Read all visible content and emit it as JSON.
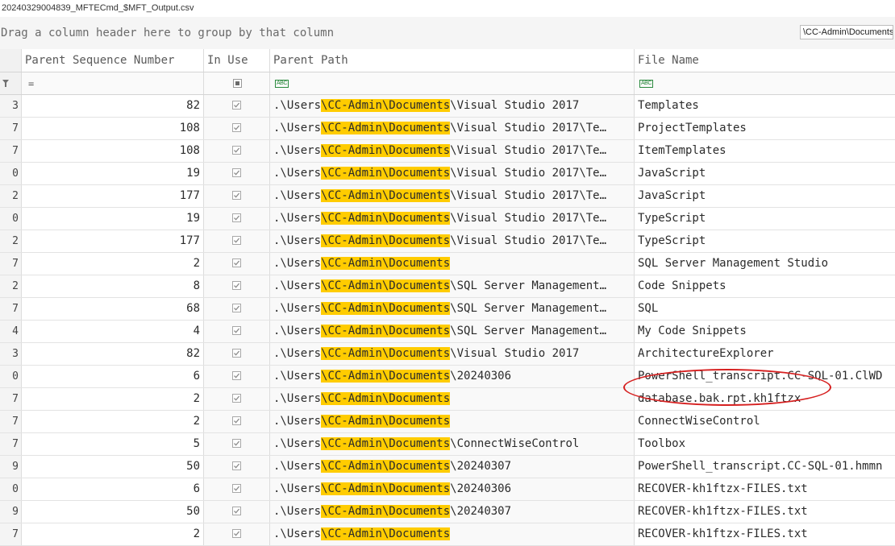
{
  "window": {
    "title": "20240329004839_MFTECmd_$MFT_Output.csv"
  },
  "group_panel": {
    "hint": "Drag a column header here to group by that column"
  },
  "search": {
    "value": "\\CC-Admin\\Documents"
  },
  "columns": {
    "parent_sequence_number": "Parent Sequence Number",
    "in_use": "In Use",
    "parent_path": "Parent Path",
    "file_name": "File Name"
  },
  "filter_row": {
    "numeric_operator": "="
  },
  "rows": [
    {
      "edge": "3",
      "psn": "82",
      "path_prefix": ".\\Users",
      "path_hl": "\\CC-Admin\\Documents",
      "path_suffix": "\\Visual Studio 2017",
      "file": "Templates"
    },
    {
      "edge": "7",
      "psn": "108",
      "path_prefix": ".\\Users",
      "path_hl": "\\CC-Admin\\Documents",
      "path_suffix": "\\Visual Studio 2017\\Te…",
      "file": "ProjectTemplates"
    },
    {
      "edge": "7",
      "psn": "108",
      "path_prefix": ".\\Users",
      "path_hl": "\\CC-Admin\\Documents",
      "path_suffix": "\\Visual Studio 2017\\Te…",
      "file": "ItemTemplates"
    },
    {
      "edge": "0",
      "psn": "19",
      "path_prefix": ".\\Users",
      "path_hl": "\\CC-Admin\\Documents",
      "path_suffix": "\\Visual Studio 2017\\Te…",
      "file": "JavaScript"
    },
    {
      "edge": "2",
      "psn": "177",
      "path_prefix": ".\\Users",
      "path_hl": "\\CC-Admin\\Documents",
      "path_suffix": "\\Visual Studio 2017\\Te…",
      "file": "JavaScript"
    },
    {
      "edge": "0",
      "psn": "19",
      "path_prefix": ".\\Users",
      "path_hl": "\\CC-Admin\\Documents",
      "path_suffix": "\\Visual Studio 2017\\Te…",
      "file": "TypeScript"
    },
    {
      "edge": "2",
      "psn": "177",
      "path_prefix": ".\\Users",
      "path_hl": "\\CC-Admin\\Documents",
      "path_suffix": "\\Visual Studio 2017\\Te…",
      "file": "TypeScript"
    },
    {
      "edge": "7",
      "psn": "2",
      "path_prefix": ".\\Users",
      "path_hl": "\\CC-Admin\\Documents",
      "path_suffix": "",
      "file": "SQL Server Management Studio"
    },
    {
      "edge": "2",
      "psn": "8",
      "path_prefix": ".\\Users",
      "path_hl": "\\CC-Admin\\Documents",
      "path_suffix": "\\SQL Server Management…",
      "file": "Code Snippets"
    },
    {
      "edge": "7",
      "psn": "68",
      "path_prefix": ".\\Users",
      "path_hl": "\\CC-Admin\\Documents",
      "path_suffix": "\\SQL Server Management…",
      "file": "SQL"
    },
    {
      "edge": "4",
      "psn": "4",
      "path_prefix": ".\\Users",
      "path_hl": "\\CC-Admin\\Documents",
      "path_suffix": "\\SQL Server Management…",
      "file": "My Code Snippets"
    },
    {
      "edge": "3",
      "psn": "82",
      "path_prefix": ".\\Users",
      "path_hl": "\\CC-Admin\\Documents",
      "path_suffix": "\\Visual Studio 2017",
      "file": "ArchitectureExplorer"
    },
    {
      "edge": "0",
      "psn": "6",
      "path_prefix": ".\\Users",
      "path_hl": "\\CC-Admin\\Documents",
      "path_suffix": "\\20240306",
      "file": "PowerShell_transcript.CC-SQL-01.ClWD"
    },
    {
      "edge": "7",
      "psn": "2",
      "path_prefix": ".\\Users",
      "path_hl": "\\CC-Admin\\Documents",
      "path_suffix": "",
      "file": "database.bak.rpt.kh1ftzx"
    },
    {
      "edge": "7",
      "psn": "2",
      "path_prefix": ".\\Users",
      "path_hl": "\\CC-Admin\\Documents",
      "path_suffix": "",
      "file": "ConnectWiseControl"
    },
    {
      "edge": "7",
      "psn": "5",
      "path_prefix": ".\\Users",
      "path_hl": "\\CC-Admin\\Documents",
      "path_suffix": "\\ConnectWiseControl",
      "file": "Toolbox"
    },
    {
      "edge": "9",
      "psn": "50",
      "path_prefix": ".\\Users",
      "path_hl": "\\CC-Admin\\Documents",
      "path_suffix": "\\20240307",
      "file": "PowerShell_transcript.CC-SQL-01.hmmn"
    },
    {
      "edge": "0",
      "psn": "6",
      "path_prefix": ".\\Users",
      "path_hl": "\\CC-Admin\\Documents",
      "path_suffix": "\\20240306",
      "file": "RECOVER-kh1ftzx-FILES.txt"
    },
    {
      "edge": "9",
      "psn": "50",
      "path_prefix": ".\\Users",
      "path_hl": "\\CC-Admin\\Documents",
      "path_suffix": "\\20240307",
      "file": "RECOVER-kh1ftzx-FILES.txt"
    },
    {
      "edge": "7",
      "psn": "2",
      "path_prefix": ".\\Users",
      "path_hl": "\\CC-Admin\\Documents",
      "path_suffix": "",
      "file": "RECOVER-kh1ftzx-FILES.txt"
    }
  ],
  "colors": {
    "highlight": "#ffcc00",
    "annotation": "#d62020",
    "abc_icon": "#2b8a3e"
  },
  "icons": {
    "filter": "funnel-icon",
    "text_filter": "abc-icon",
    "checkbox": "checkmark-icon"
  }
}
